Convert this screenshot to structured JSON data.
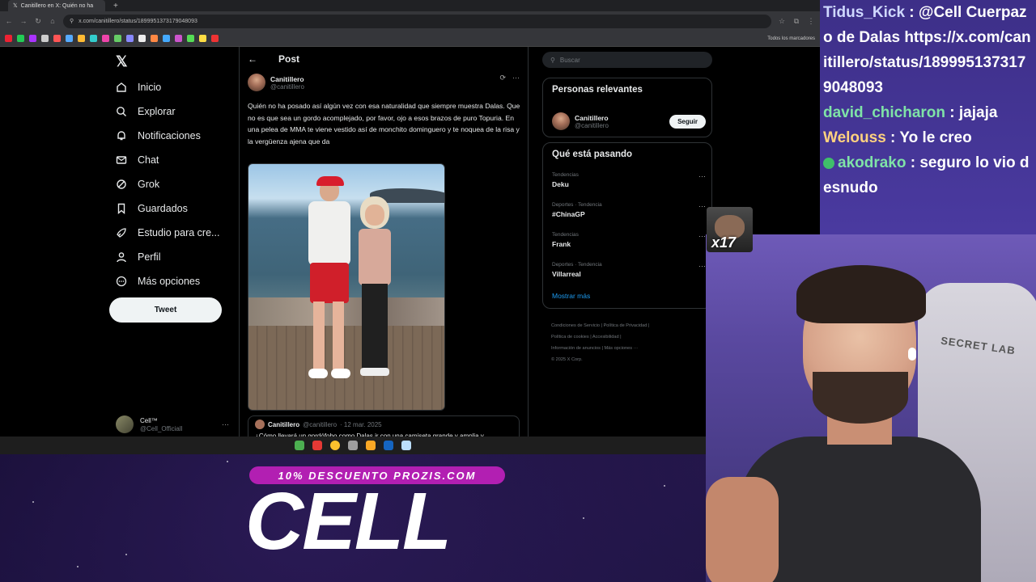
{
  "browser": {
    "tab_title": "Canitillero en X: Quién no ha",
    "url": "x.com/canitillero/status/1899951373179048093",
    "bookmarks_all": "Todos los marcadores"
  },
  "nav": {
    "items": [
      {
        "label": "Inicio",
        "icon": "home-icon"
      },
      {
        "label": "Explorar",
        "icon": "search-icon"
      },
      {
        "label": "Notificaciones",
        "icon": "bell-icon"
      },
      {
        "label": "Chat",
        "icon": "mail-icon"
      },
      {
        "label": "Grok",
        "icon": "grok-icon"
      },
      {
        "label": "Guardados",
        "icon": "bookmark-icon"
      },
      {
        "label": "Estudio para cre...",
        "icon": "rocket-icon"
      },
      {
        "label": "Perfil",
        "icon": "user-icon"
      },
      {
        "label": "Más opciones",
        "icon": "more-icon"
      }
    ],
    "tweet_button": "Tweet",
    "account": {
      "name": "Cell™",
      "handle": "@Cell_Officiall"
    }
  },
  "post": {
    "header": "Post",
    "author_name": "Canitillero",
    "author_handle": "@canitillero",
    "text": "Quién no ha posado así algún vez con esa naturalidad que siempre muestra Dalas. Que no es que sea un gordo acomplejado, por favor, ojo a esos brazos de puro Topuria. En una pelea de MMA te viene vestido así de monchito dominguero y te noquea de la risa y la vergüenza ajena que da",
    "quote": {
      "name": "Canitillero",
      "handle": "@canitillero",
      "date": "· 12 mar. 2025",
      "text": "¿Cómo llevará un gordófobo como Dalas ir con una camiseta grande y amplia y"
    }
  },
  "sidebar": {
    "search_placeholder": "Buscar",
    "relevant_title": "Personas relevantes",
    "relevant_person": {
      "name": "Canitillero",
      "handle": "@canitillero",
      "button": "Seguir"
    },
    "trends_title": "Qué está pasando",
    "trends": [
      {
        "category": "Tendencias",
        "name": "Deku"
      },
      {
        "category": "Deportes · Tendencia",
        "name": "#ChinaGP"
      },
      {
        "category": "Tendencias",
        "name": "Frank"
      },
      {
        "category": "Deportes · Tendencia",
        "name": "Villarreal"
      }
    ],
    "show_more": "Mostrar más",
    "footer": [
      "Condiciones de Servicio",
      "Política de Privacidad",
      "Política de cookies",
      "Accesibilidad",
      "Información de anuncios",
      "Más opciones ···",
      "© 2025 X Corp."
    ]
  },
  "chat": {
    "messages": [
      {
        "user": "Tidus_Kick",
        "text": " : @Cell Cuerpazo de Dalas https://x.com/canitillero/status/1899951373179048093",
        "user_color": "#cfd8ff"
      },
      {
        "user": "david_chicharon",
        "text": " : jajaja",
        "user_color": "#7fe3a7"
      },
      {
        "user": "Welouss",
        "text": " : Yo le creo",
        "user_color": "#ffd27f"
      },
      {
        "user": "akodrako",
        "text": " : seguro lo vio desnudo",
        "user_color": "#7fe3a7"
      }
    ]
  },
  "overlay": {
    "emote_count": "x17",
    "promo": "10% DESCUENTO PROZIS.COM",
    "brand": "CELL",
    "chair_brand": "SECRET LAB"
  }
}
